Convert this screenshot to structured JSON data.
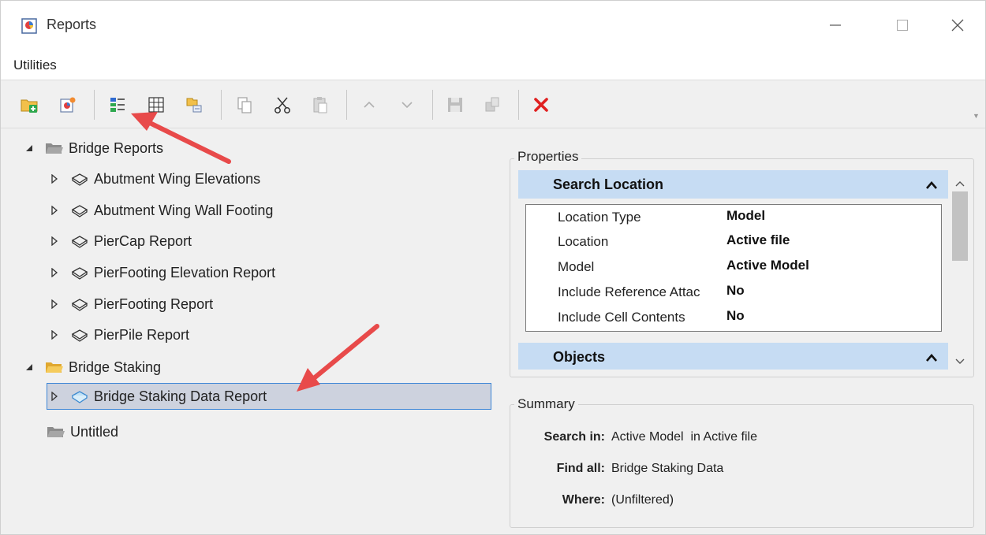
{
  "window": {
    "title": "Reports"
  },
  "menu": {
    "items": [
      "Utilities"
    ]
  },
  "toolbar": {
    "buttons": [
      "new-folder-icon",
      "new-report-icon",
      "report-properties-icon",
      "grid-icon",
      "select-elements-icon",
      "copy-icon",
      "cut-icon",
      "paste-icon",
      "move-up-icon",
      "move-down-icon",
      "save-icon",
      "save-as-icon",
      "delete-icon"
    ]
  },
  "tree": {
    "bridge_reports": {
      "label": "Bridge Reports",
      "children": [
        "Abutment Wing Elevations",
        "Abutment Wing Wall Footing",
        "PierCap Report",
        "PierFooting Elevation Report",
        "PierFooting Report",
        "PierPile Report"
      ]
    },
    "bridge_staking": {
      "label": "Bridge Staking",
      "children": [
        "Bridge Staking Data Report"
      ]
    },
    "untitled": {
      "label": "Untitled"
    }
  },
  "properties": {
    "group_title": "Properties",
    "search_location": {
      "header": "Search Location",
      "rows": [
        {
          "key": "Location Type",
          "value": "Model"
        },
        {
          "key": "Location",
          "value": "Active file"
        },
        {
          "key": "Model",
          "value": "Active Model"
        },
        {
          "key": "Include Reference Attac",
          "value": "No"
        },
        {
          "key": "Include Cell Contents",
          "value": "No"
        }
      ]
    },
    "objects": {
      "header": "Objects"
    }
  },
  "summary": {
    "group_title": "Summary",
    "search_in_label": "Search in:",
    "search_in_value": "Active Model  in Active file",
    "find_all_label": "Find all:",
    "find_all_value": "Bridge Staking Data",
    "where_label": "Where:",
    "where_value": "(Unfiltered)"
  },
  "colors": {
    "accent": "#c6dcf3",
    "selection": "#cdd2de",
    "selection_border": "#3d86d6",
    "annotation": "#e84a4a",
    "delete": "#e02020"
  }
}
